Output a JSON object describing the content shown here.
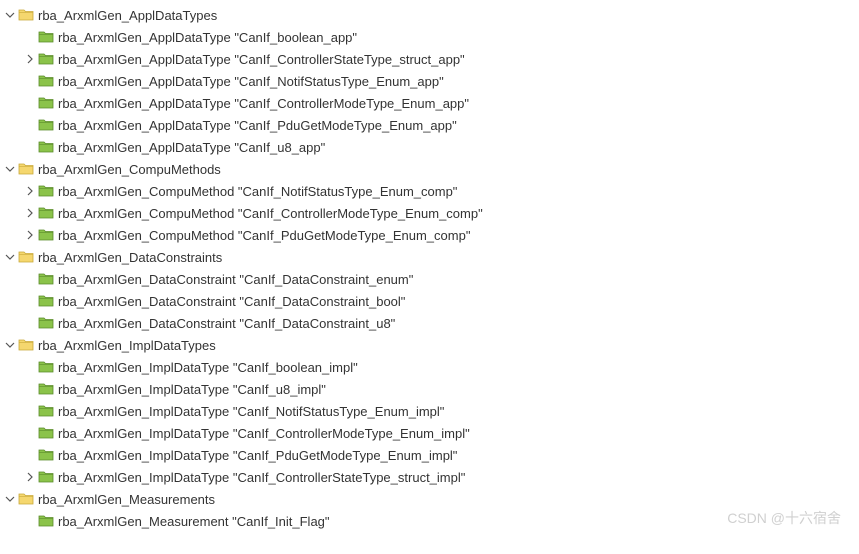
{
  "watermark": "CSDN @十六宿舍",
  "tree": [
    {
      "name": "rba_ArxmlGen_ApplDataTypes",
      "expanded": true,
      "iconColor": "yellow",
      "children": [
        {
          "name": "rba_ArxmlGen_ApplDataType \"CanIf_boolean_app\"",
          "expandable": false,
          "iconColor": "green"
        },
        {
          "name": "rba_ArxmlGen_ApplDataType \"CanIf_ControllerStateType_struct_app\"",
          "expandable": true,
          "iconColor": "green"
        },
        {
          "name": "rba_ArxmlGen_ApplDataType \"CanIf_NotifStatusType_Enum_app\"",
          "expandable": false,
          "iconColor": "green"
        },
        {
          "name": "rba_ArxmlGen_ApplDataType \"CanIf_ControllerModeType_Enum_app\"",
          "expandable": false,
          "iconColor": "green"
        },
        {
          "name": "rba_ArxmlGen_ApplDataType \"CanIf_PduGetModeType_Enum_app\"",
          "expandable": false,
          "iconColor": "green"
        },
        {
          "name": "rba_ArxmlGen_ApplDataType \"CanIf_u8_app\"",
          "expandable": false,
          "iconColor": "green"
        }
      ]
    },
    {
      "name": "rba_ArxmlGen_CompuMethods",
      "expanded": true,
      "iconColor": "yellow",
      "children": [
        {
          "name": "rba_ArxmlGen_CompuMethod \"CanIf_NotifStatusType_Enum_comp\"",
          "expandable": true,
          "iconColor": "green"
        },
        {
          "name": "rba_ArxmlGen_CompuMethod \"CanIf_ControllerModeType_Enum_comp\"",
          "expandable": true,
          "iconColor": "green"
        },
        {
          "name": "rba_ArxmlGen_CompuMethod \"CanIf_PduGetModeType_Enum_comp\"",
          "expandable": true,
          "iconColor": "green"
        }
      ]
    },
    {
      "name": "rba_ArxmlGen_DataConstraints",
      "expanded": true,
      "iconColor": "yellow",
      "children": [
        {
          "name": "rba_ArxmlGen_DataConstraint \"CanIf_DataConstraint_enum\"",
          "expandable": false,
          "iconColor": "green"
        },
        {
          "name": "rba_ArxmlGen_DataConstraint \"CanIf_DataConstraint_bool\"",
          "expandable": false,
          "iconColor": "green"
        },
        {
          "name": "rba_ArxmlGen_DataConstraint \"CanIf_DataConstraint_u8\"",
          "expandable": false,
          "iconColor": "green"
        }
      ]
    },
    {
      "name": "rba_ArxmlGen_ImplDataTypes",
      "expanded": true,
      "iconColor": "yellow",
      "children": [
        {
          "name": "rba_ArxmlGen_ImplDataType \"CanIf_boolean_impl\"",
          "expandable": false,
          "iconColor": "green"
        },
        {
          "name": "rba_ArxmlGen_ImplDataType \"CanIf_u8_impl\"",
          "expandable": false,
          "iconColor": "green"
        },
        {
          "name": "rba_ArxmlGen_ImplDataType \"CanIf_NotifStatusType_Enum_impl\"",
          "expandable": false,
          "iconColor": "green"
        },
        {
          "name": "rba_ArxmlGen_ImplDataType \"CanIf_ControllerModeType_Enum_impl\"",
          "expandable": false,
          "iconColor": "green"
        },
        {
          "name": "rba_ArxmlGen_ImplDataType \"CanIf_PduGetModeType_Enum_impl\"",
          "expandable": false,
          "iconColor": "green"
        },
        {
          "name": "rba_ArxmlGen_ImplDataType \"CanIf_ControllerStateType_struct_impl\"",
          "expandable": true,
          "iconColor": "green"
        }
      ]
    },
    {
      "name": "rba_ArxmlGen_Measurements",
      "expanded": true,
      "iconColor": "yellow",
      "children": [
        {
          "name": "rba_ArxmlGen_Measurement \"CanIf_Init_Flag\"",
          "expandable": false,
          "iconColor": "green"
        }
      ]
    }
  ]
}
